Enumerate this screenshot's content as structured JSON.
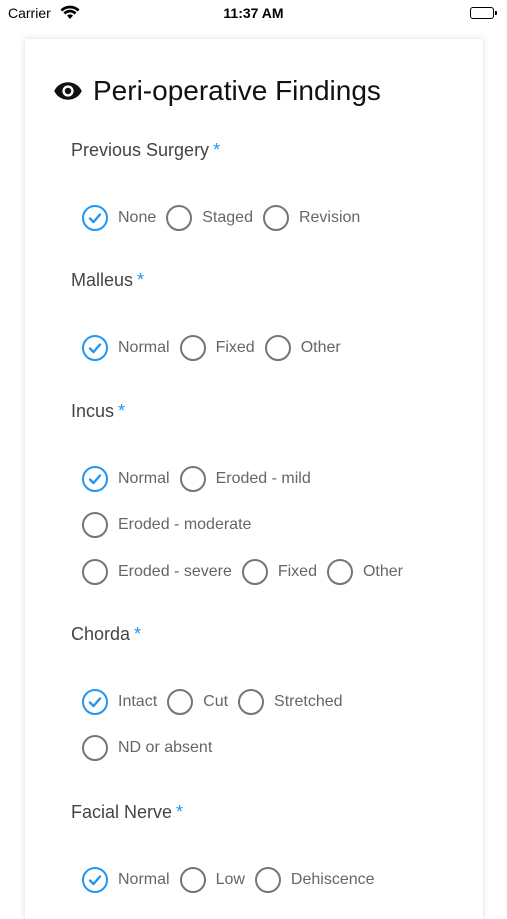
{
  "status_bar": {
    "carrier": "Carrier",
    "time": "11:37 AM"
  },
  "card": {
    "title": "Peri-operative Findings",
    "icon": "eye-icon"
  },
  "accent_color": "#2196F3",
  "sections": [
    {
      "label": "Previous Surgery",
      "required": "*",
      "rows": [
        [
          "None",
          "Staged",
          "Revision"
        ]
      ],
      "selected": "None"
    },
    {
      "label": "Malleus",
      "required": "*",
      "rows": [
        [
          "Normal",
          "Fixed",
          "Other"
        ]
      ],
      "selected": "Normal"
    },
    {
      "label": "Incus",
      "required": "*",
      "rows": [
        [
          "Normal",
          "Eroded - mild"
        ],
        [
          "Eroded - moderate"
        ],
        [
          "Eroded - severe",
          "Fixed",
          "Other"
        ]
      ],
      "selected": "Normal"
    },
    {
      "label": "Chorda",
      "required": "*",
      "rows": [
        [
          "Intact",
          "Cut",
          "Stretched"
        ],
        [
          "ND or absent"
        ]
      ],
      "selected": "Intact"
    },
    {
      "label": "Facial Nerve",
      "required": "*",
      "rows": [
        [
          "Normal",
          "Low",
          "Dehiscence"
        ]
      ],
      "selected": "Normal"
    }
  ]
}
